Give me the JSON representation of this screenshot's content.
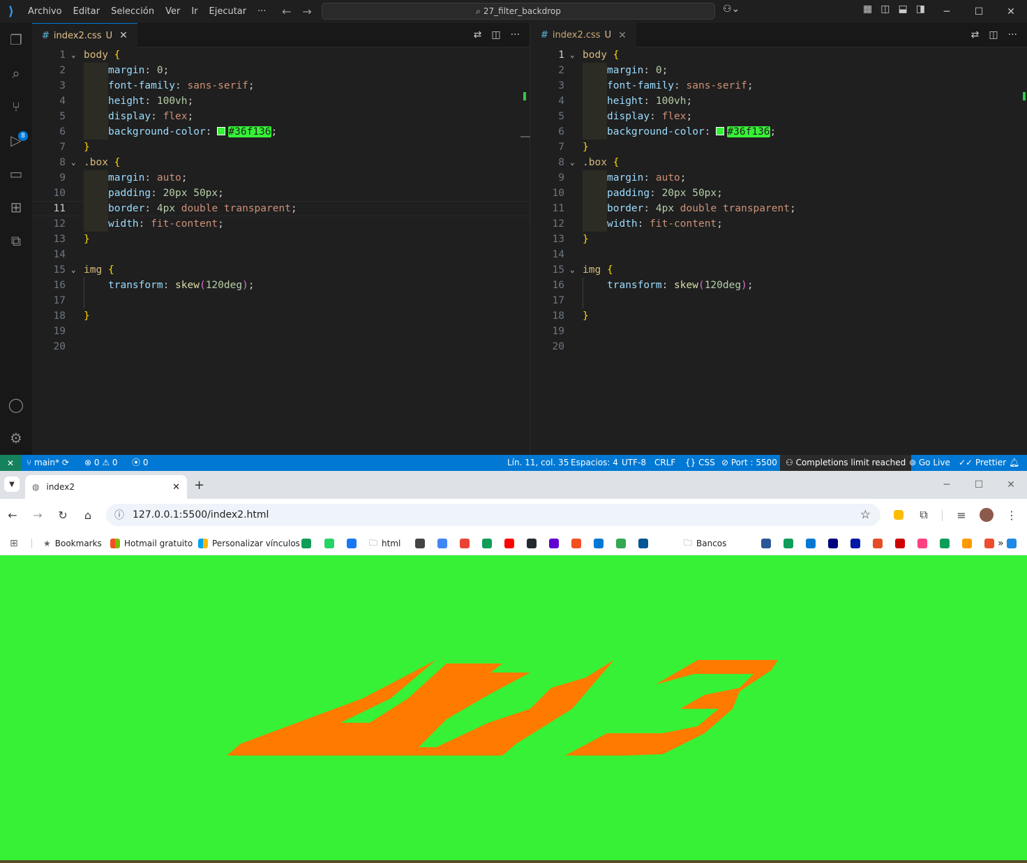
{
  "vscode": {
    "menu": [
      "Archivo",
      "Editar",
      "Selección",
      "Ver",
      "Ir",
      "Ejecutar",
      "···"
    ],
    "search_text": "27_filter_backdrop",
    "source_control_badge": "8",
    "left_editor": {
      "tab_name": "index2.css",
      "tab_status": "U",
      "close": "✕"
    },
    "right_editor": {
      "tab_name": "index2.css",
      "tab_status": "U",
      "close": "✕"
    },
    "line_numbers": [
      "1",
      "2",
      "3",
      "4",
      "5",
      "6",
      "7",
      "8",
      "9",
      "10",
      "11",
      "12",
      "13",
      "14",
      "15",
      "16",
      "17",
      "18",
      "19",
      "20"
    ],
    "current_line": 11,
    "code": {
      "body_sel": "body",
      "brace_open": "{",
      "brace_close": "}",
      "margin_prop": "margin",
      "margin_val": "0",
      "font_prop": "font-family",
      "font_val": "sans-serif",
      "height_prop": "height",
      "height_val": "100vh",
      "display_prop": "display",
      "display_val": "flex",
      "bg_prop": "background-color",
      "bg_val": "#36f136",
      "box_sel": ".box",
      "bmargin_val": "auto",
      "padding_prop": "padding",
      "padding_val": "20px 50px",
      "border_prop": "border",
      "border_num": "4px",
      "border_val": "double transparent",
      "width_prop": "width",
      "width_val": "fit-content",
      "img_sel": "img",
      "transform_prop": "transform",
      "transform_fn": "skew",
      "transform_arg": "120deg"
    },
    "statusbar": {
      "branch": "main*",
      "errors": "0",
      "warnings": "0",
      "ports": "0",
      "position": "Lín. 11, col. 35",
      "spaces": "Espacios: 4",
      "encoding": "UTF-8",
      "eol": "CRLF",
      "language": "CSS",
      "port": "Port : 5500",
      "completions": "Completions limit reached",
      "golive": "Go Live",
      "prettier": "Prettier"
    }
  },
  "chrome": {
    "tab_title": "index2",
    "url": "127.0.0.1:5500/index2.html",
    "bookmarks": [
      {
        "label": "Bookmarks",
        "color": "#5f6368"
      },
      {
        "label": "Hotmail gratuito",
        "color": "#f25022"
      },
      {
        "label": "Personalizar vínculos",
        "color": "#7fba00"
      },
      {
        "label": "html",
        "color": "#5f6368"
      },
      {
        "label": "Bancos",
        "color": "#5f6368"
      }
    ],
    "bookmark_icon_colors": [
      "#0f9d58",
      "#25d366",
      "#1877f2",
      "#444444",
      "#4285f4",
      "#ea4335",
      "#0f9d58",
      "#ff0000",
      "#24292e",
      "#6001d2",
      "#f25022",
      "#0078d4",
      "#34a853",
      "#005596",
      "#2b579a",
      "#0f9d58",
      "#0078d4",
      "#000080",
      "#0019a5",
      "#e44d26",
      "#cc0000",
      "#ff4081",
      "#0f9d58",
      "#ff9900",
      "#ee4d2d",
      "#1e88e5"
    ]
  },
  "page": {
    "background": "#36f136",
    "image_color": "#ff7a00"
  }
}
